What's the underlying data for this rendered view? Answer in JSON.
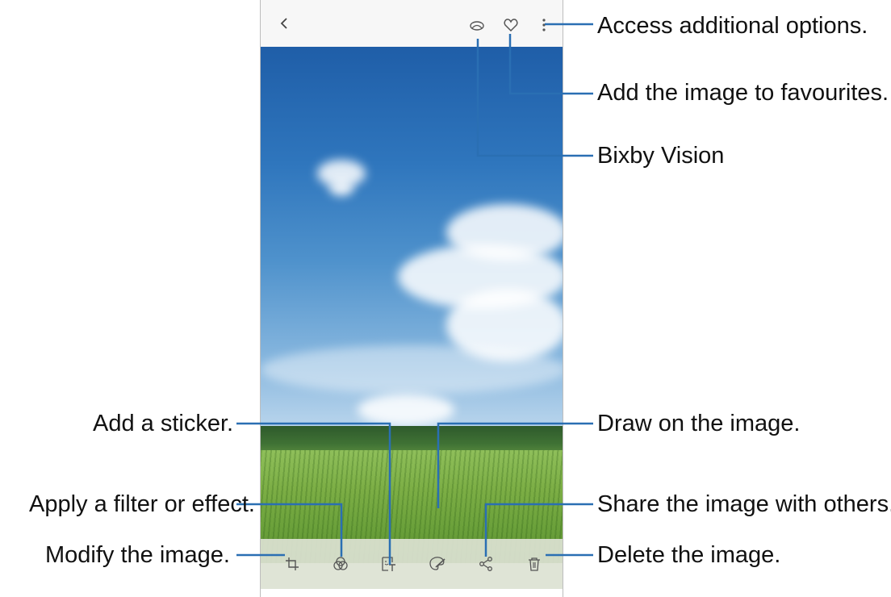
{
  "callouts": {
    "more_options": "Access additional options.",
    "favourite": "Add the image to favourites.",
    "bixby_vision": "Bixby Vision",
    "draw": "Draw on the image.",
    "share": "Share the image with others.",
    "delete": "Delete the image.",
    "sticker": "Add a sticker.",
    "filter": "Apply a filter or effect.",
    "modify": "Modify the image."
  },
  "icons": {
    "back": "back-arrow-icon",
    "bixby": "bixby-vision-icon",
    "favourite": "heart-icon",
    "more": "more-options-icon",
    "edit": "crop-rotate-icon",
    "filter": "filter-icon",
    "sticker": "sticker-icon",
    "draw": "draw-brush-icon",
    "share": "share-icon",
    "delete": "trash-icon"
  },
  "colors": {
    "callout_line": "#2a6fb3",
    "icon": "#555555"
  }
}
